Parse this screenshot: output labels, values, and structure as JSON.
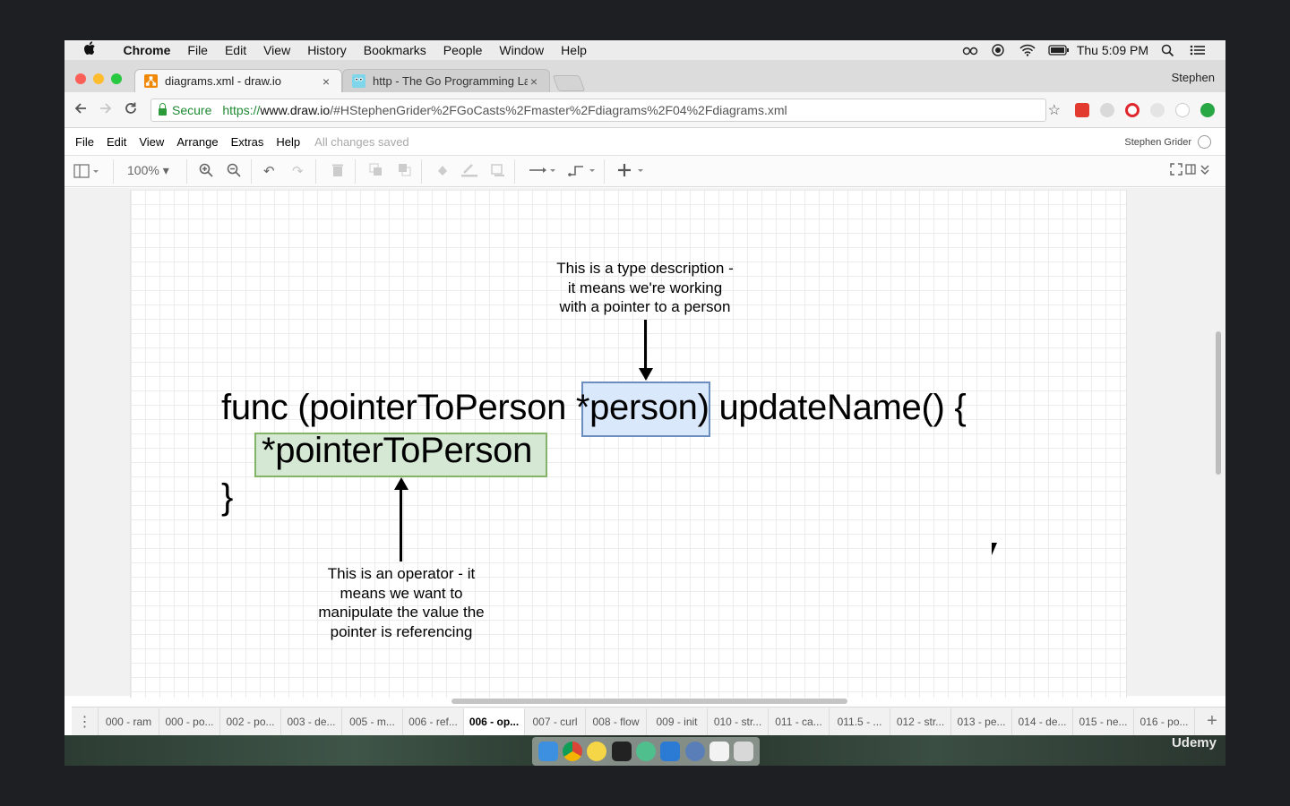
{
  "menubar": {
    "app": "Chrome",
    "items": [
      "File",
      "Edit",
      "View",
      "History",
      "Bookmarks",
      "People",
      "Window",
      "Help"
    ],
    "clock": "Thu 5:09 PM"
  },
  "browser": {
    "tabs": [
      {
        "label": "diagrams.xml - draw.io",
        "active": true
      },
      {
        "label": "http - The Go Programming La",
        "active": false
      }
    ],
    "profile": "Stephen",
    "secure_label": "Secure",
    "url_scheme": "https://",
    "url_host": "www.draw.io",
    "url_rest": "/#HStephenGrider%2FGoCasts%2Fmaster%2Fdiagrams%2F04%2Fdiagrams.xml"
  },
  "drawio": {
    "menu": [
      "File",
      "Edit",
      "View",
      "Arrange",
      "Extras",
      "Help"
    ],
    "saved_status": "All changes saved",
    "user": "Stephen Grider",
    "zoom": "100%"
  },
  "diagram": {
    "line1_prefix": "func (pointerToPerson ",
    "highlight_type": "*person",
    "line1_suffix": ") updateName() {",
    "highlight_operator": "*pointerToPerson",
    "closing_brace": "}",
    "note_top": [
      "This is a type description -",
      "it means we're working",
      "with a pointer to a person"
    ],
    "note_bottom": [
      "This is an operator - it",
      "means we want to",
      "manipulate the value the",
      "pointer is referencing"
    ]
  },
  "page_tabs": [
    "000 - ram",
    "000 - po...",
    "002 - po...",
    "003 - de...",
    "005 - m...",
    "006 - ref...",
    "006 - op...",
    "007 - curl",
    "008 - flow",
    "009 - init",
    "010 - str...",
    "011 - ca...",
    "011.5 - ...",
    "012 - str...",
    "013 - pe...",
    "014 - de...",
    "015 - ne...",
    "016 - po..."
  ],
  "active_page_tab": "006 - op...",
  "watermark": "Udemy",
  "colors": {
    "type_box_fill": "#dae8fc",
    "type_box_stroke": "#6c8ebf",
    "operator_box_fill": "#d5e8d4",
    "operator_box_stroke": "#82b366"
  }
}
